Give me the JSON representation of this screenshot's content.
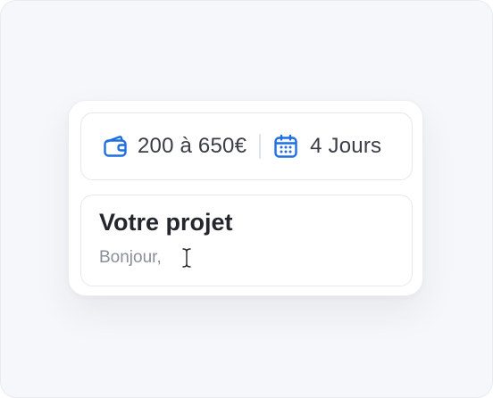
{
  "budget": {
    "icon": "wallet-icon",
    "label": "200 à 650€"
  },
  "duration": {
    "icon": "calendar-icon",
    "label": "4 Jours"
  },
  "message": {
    "title": "Votre projet",
    "value": "Bonjour,"
  },
  "colors": {
    "accent": "#1f6fe0",
    "canvas": "#f6f7fa",
    "text": "#3a3d45",
    "muted": "#8a8e96"
  }
}
